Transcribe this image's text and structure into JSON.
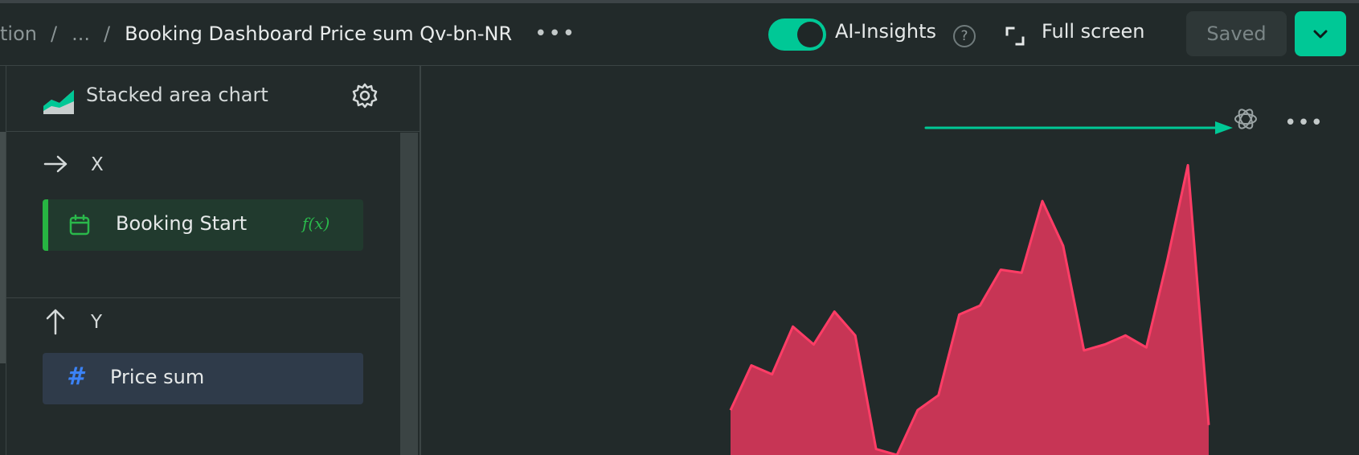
{
  "header": {
    "crumb_start": "tion",
    "crumb_sep1": "/",
    "crumb_ellipsis": "...",
    "crumb_sep2": "/",
    "title": "Booking Dashboard Price sum Qv-bn-NR",
    "more": "•••",
    "ai_insights_label": "AI-Insights",
    "ai_insights_on": true,
    "help": "?",
    "fullscreen_label": "Full screen",
    "saved_label": "Saved"
  },
  "panel": {
    "chart_type": "Stacked area chart",
    "x_axis": {
      "label": "X",
      "field": "Booking Start",
      "fx": "f(x)",
      "icon": "calendar-icon"
    },
    "y_axis": {
      "label": "Y",
      "field": "Price sum",
      "icon": "hash-icon",
      "hash": "#"
    }
  },
  "plot": {
    "more": "•••"
  },
  "colors": {
    "accent": "#00c896",
    "area_fill": "#c73555",
    "area_stroke": "#ff3d66",
    "x_field_accent": "#27b542",
    "y_field_hash": "#3b82f6"
  },
  "chart_data": {
    "type": "area",
    "series": [
      {
        "values": [
          0.15,
          0.3,
          0.27,
          0.43,
          0.37,
          0.48,
          0.4,
          0.02,
          0.0,
          0.15,
          0.2,
          0.47,
          0.5,
          0.62,
          0.61,
          0.85,
          0.7,
          0.35,
          0.37,
          0.4,
          0.36,
          0.65,
          0.97,
          0.1
        ]
      }
    ]
  }
}
